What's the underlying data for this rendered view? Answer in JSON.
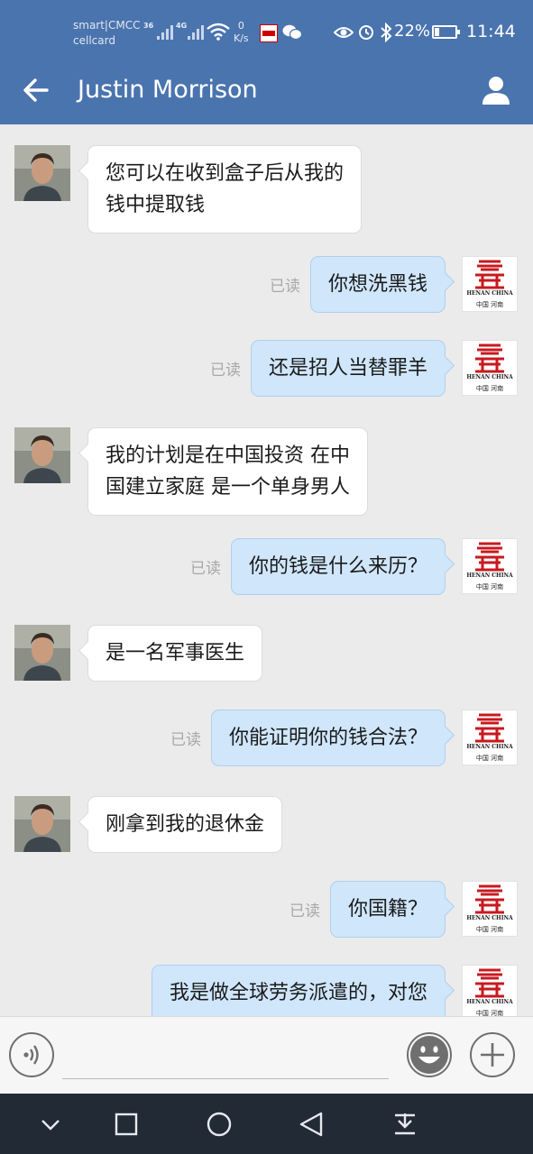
{
  "status_bar": {
    "carrier_line1": "smart|CMCC",
    "carrier_line2": "cellcard",
    "signal1_label": "36",
    "signal2_label": "4G",
    "net_speed_value": "0",
    "net_speed_unit": "K/s",
    "battery_percent": "22%",
    "battery_level": 0.22,
    "time": "11:44"
  },
  "header": {
    "title": "Justin Morrison",
    "back_icon": "arrow-left-icon",
    "contact_icon": "person-icon"
  },
  "messages": [
    {
      "side": "in",
      "lines": [
        "您可以在收到盒子后从我的",
        "钱中提取钱"
      ]
    },
    {
      "side": "out",
      "lines": [
        "你想洗黑钱"
      ],
      "status": "已读"
    },
    {
      "side": "out",
      "lines": [
        "还是招人当替罪羊"
      ],
      "status": "已读"
    },
    {
      "side": "in",
      "lines": [
        "我的计划是在中国投资 在中",
        "国建立家庭 是一个单身男人"
      ]
    },
    {
      "side": "out",
      "lines": [
        "你的钱是什么来历？"
      ],
      "status": "已读"
    },
    {
      "side": "in",
      "lines": [
        "是一名军事医生"
      ]
    },
    {
      "side": "out",
      "lines": [
        "你能证明你的钱合法？"
      ],
      "status": "已读"
    },
    {
      "side": "in",
      "lines": [
        "刚拿到我的退休金"
      ]
    },
    {
      "side": "out",
      "lines": [
        "你国籍？"
      ],
      "status": "已读"
    },
    {
      "side": "out",
      "lines": [
        "我是做全球劳务派遣的，对您",
        "…"
      ]
    }
  ],
  "my_avatar": {
    "text_top": "HENAN CHINA",
    "text_bottom": "中国 河南"
  },
  "input_bar": {
    "voice_icon": "voice-wave-icon",
    "emoji_icon": "smiley-icon",
    "plus_icon": "plus-icon",
    "text_value": ""
  },
  "nav_bar": {
    "icons": [
      "chevron-down-icon",
      "square-recents-icon",
      "circle-home-icon",
      "triangle-back-icon",
      "notification-pull-icon"
    ]
  }
}
